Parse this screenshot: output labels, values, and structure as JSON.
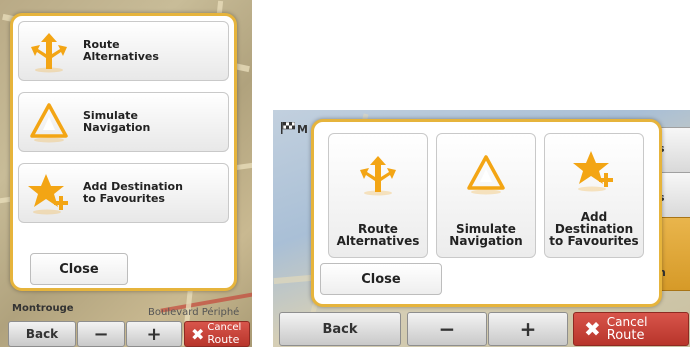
{
  "left": {
    "menu": {
      "items": [
        {
          "label_line1": "Route",
          "label_line2": "Alternatives",
          "icon": "route-alternatives-icon"
        },
        {
          "label_line1": "Simulate",
          "label_line2": "Navigation",
          "icon": "simulate-navigation-icon"
        },
        {
          "label_line1": "Add Destination",
          "label_line2": "to Favourites",
          "icon": "add-favourite-star-icon"
        }
      ],
      "close_label": "Close"
    },
    "map_labels": {
      "montrouge": "Montrouge",
      "peripherique": "Boulevard Périphé"
    },
    "bottom_bar": {
      "back": "Back",
      "minus": "−",
      "plus": "+",
      "cancel_line1": "Cancel",
      "cancel_line2": "Route"
    }
  },
  "right": {
    "menu": {
      "tiles": [
        {
          "label_line1": "",
          "label_line2": "Route",
          "label_line3": "Alternatives",
          "icon": "route-alternatives-icon"
        },
        {
          "label_line1": "",
          "label_line2": "Simulate",
          "label_line3": "Navigation",
          "icon": "simulate-navigation-icon"
        },
        {
          "label_line1": "Add",
          "label_line2": "Destination",
          "label_line3": "to Favourites",
          "icon": "add-favourite-star-icon"
        }
      ],
      "close_label": "Close"
    },
    "top_label": "M",
    "side_letters": [
      "s",
      "s",
      "h"
    ],
    "bottom_bar": {
      "back": "Back",
      "minus": "−",
      "plus": "+",
      "cancel_line1": "Cancel",
      "cancel_line2": "Route"
    }
  },
  "colors": {
    "accent_border": "#e6b43c",
    "icon_orange": "#f3a514",
    "cancel_red": "#c0392b"
  }
}
